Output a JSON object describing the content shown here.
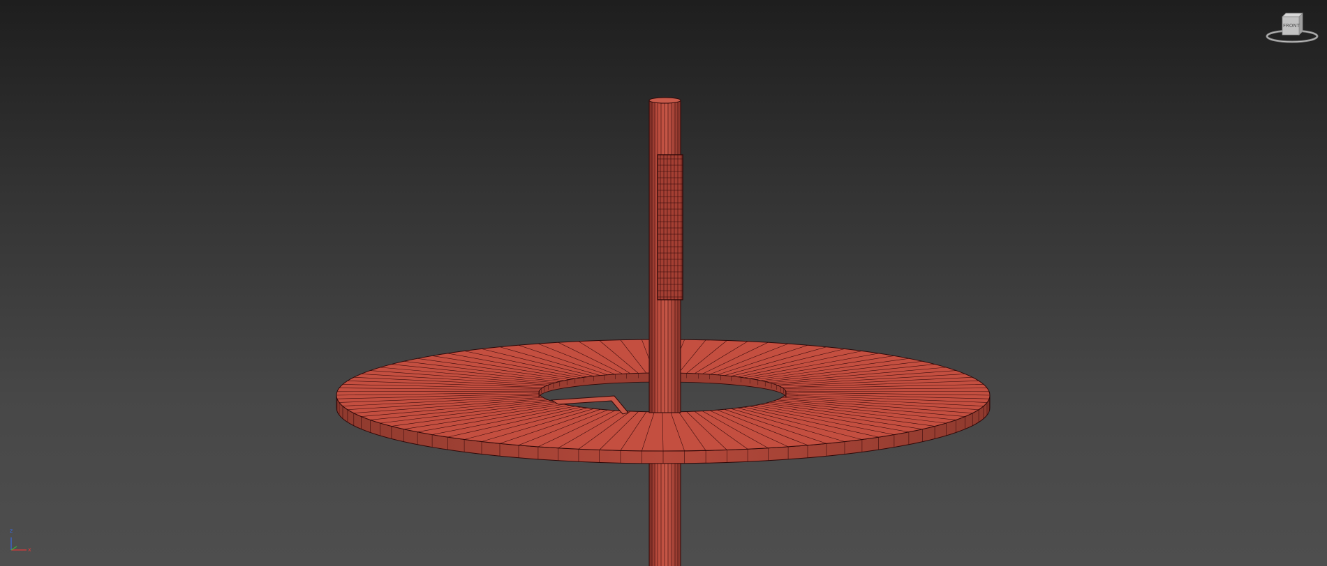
{
  "viewport": {
    "viewcube": {
      "face_label": "FRONT",
      "icon": "viewcube-icon"
    },
    "axis_tripod": {
      "x_label": "x",
      "y_label": "y",
      "z_label": "z",
      "x_color": "#e03a3a",
      "y_color": "#3ab43a",
      "z_color": "#3a6ae0"
    },
    "model": {
      "wire_color": "#2e0808",
      "shade_color": "#c44f40",
      "objects": [
        "vertical-pole",
        "pole-sleeve",
        "ring-disc",
        "bracket"
      ]
    }
  }
}
